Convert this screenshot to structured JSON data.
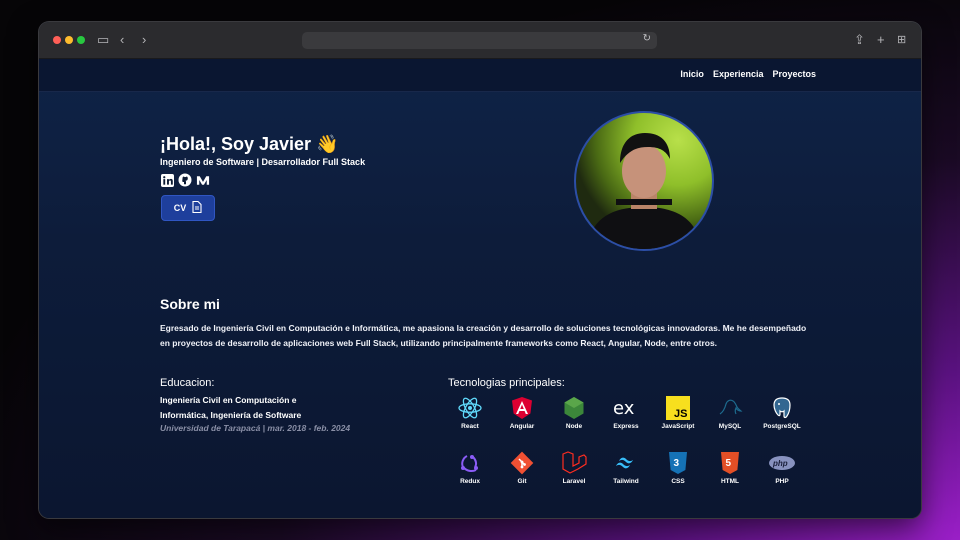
{
  "browser": {
    "reload_icon": "reload-icon"
  },
  "nav": {
    "links": [
      "Inicio",
      "Experiencia",
      "Proyectos"
    ]
  },
  "hero": {
    "title": "¡Hola!, Soy Javier 👋",
    "subtitle": "Ingeniero de Software | Desarrollador Full Stack",
    "cv_label": "CV"
  },
  "about": {
    "title": "Sobre mi",
    "text": "Egresado de Ingeniería Civil en Computación e Informática, me apasiona la creación y desarrollo de soluciones tecnológicas innovadoras. Me he desempeñado en proyectos de desarrollo de aplicaciones web Full Stack, utilizando principalmente frameworks como React, Angular, Node, entre otros."
  },
  "education": {
    "heading": "Educacion:",
    "degree": "Ingeniería Civil en Computación e Informática, Ingeniería de Software",
    "university": "Universidad de Tarapacá | mar. 2018 - feb. 2024"
  },
  "tech": {
    "heading": "Tecnologias principales:",
    "items": [
      "React",
      "Angular",
      "Node",
      "Express",
      "JavaScript",
      "MySQL",
      "PostgreSQL",
      "Redux",
      "Git",
      "Laravel",
      "Tailwind",
      "CSS",
      "HTML",
      "PHP"
    ]
  },
  "colors": {
    "accent": "#1e3f9c",
    "background": "#0c1a33"
  }
}
